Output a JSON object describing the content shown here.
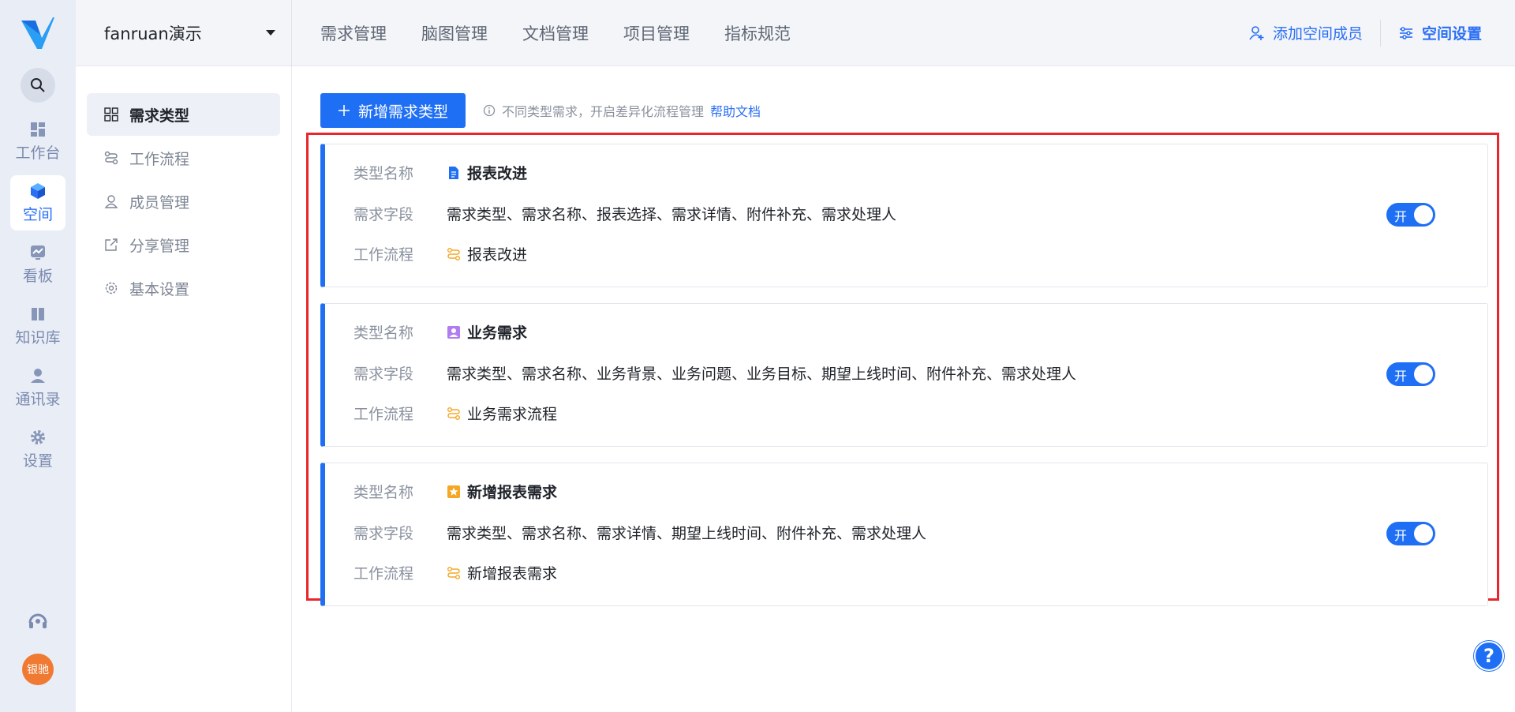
{
  "rail": {
    "items": [
      {
        "label": "工作台",
        "icon": "dashboard-icon"
      },
      {
        "label": "空间",
        "icon": "cube-icon",
        "active": true
      },
      {
        "label": "看板",
        "icon": "chart-board-icon"
      },
      {
        "label": "知识库",
        "icon": "book-icon"
      },
      {
        "label": "通讯录",
        "icon": "contacts-icon"
      },
      {
        "label": "设置",
        "icon": "gear-icon"
      }
    ],
    "avatar_text": "银驰"
  },
  "header": {
    "space_name": "fanruan演示",
    "nav": [
      "需求管理",
      "脑图管理",
      "文档管理",
      "项目管理",
      "指标规范"
    ],
    "add_member": "添加空间成员",
    "space_settings": "空间设置"
  },
  "subnav": {
    "items": [
      "需求类型",
      "工作流程",
      "成员管理",
      "分享管理",
      "基本设置"
    ]
  },
  "toolbar": {
    "add_button": "新增需求类型",
    "hint": "不同类型需求，开启差异化流程管理",
    "help_link": "帮助文档"
  },
  "labels": {
    "type_name": "类型名称",
    "fields": "需求字段",
    "workflow": "工作流程"
  },
  "cards": [
    {
      "name": "报表改进",
      "fields": "需求类型、需求名称、报表选择、需求详情、附件补充、需求处理人",
      "workflow": "报表改进",
      "icon_color": "#1f6ff5",
      "toggle": "开"
    },
    {
      "name": "业务需求",
      "fields": "需求类型、需求名称、业务背景、业务问题、业务目标、期望上线时间、附件补充、需求处理人",
      "workflow": "业务需求流程",
      "icon_color": "#b07cf0",
      "toggle": "开"
    },
    {
      "name": "新增报表需求",
      "fields": "需求类型、需求名称、需求详情、期望上线时间、附件补充、需求处理人",
      "workflow": "新增报表需求",
      "icon_color": "#f5a623",
      "toggle": "开"
    }
  ],
  "help_fab": "?",
  "colors": {
    "accent": "#1f6ff5",
    "highlight_border": "#e8262b",
    "rail_bg": "#e9edf5"
  }
}
